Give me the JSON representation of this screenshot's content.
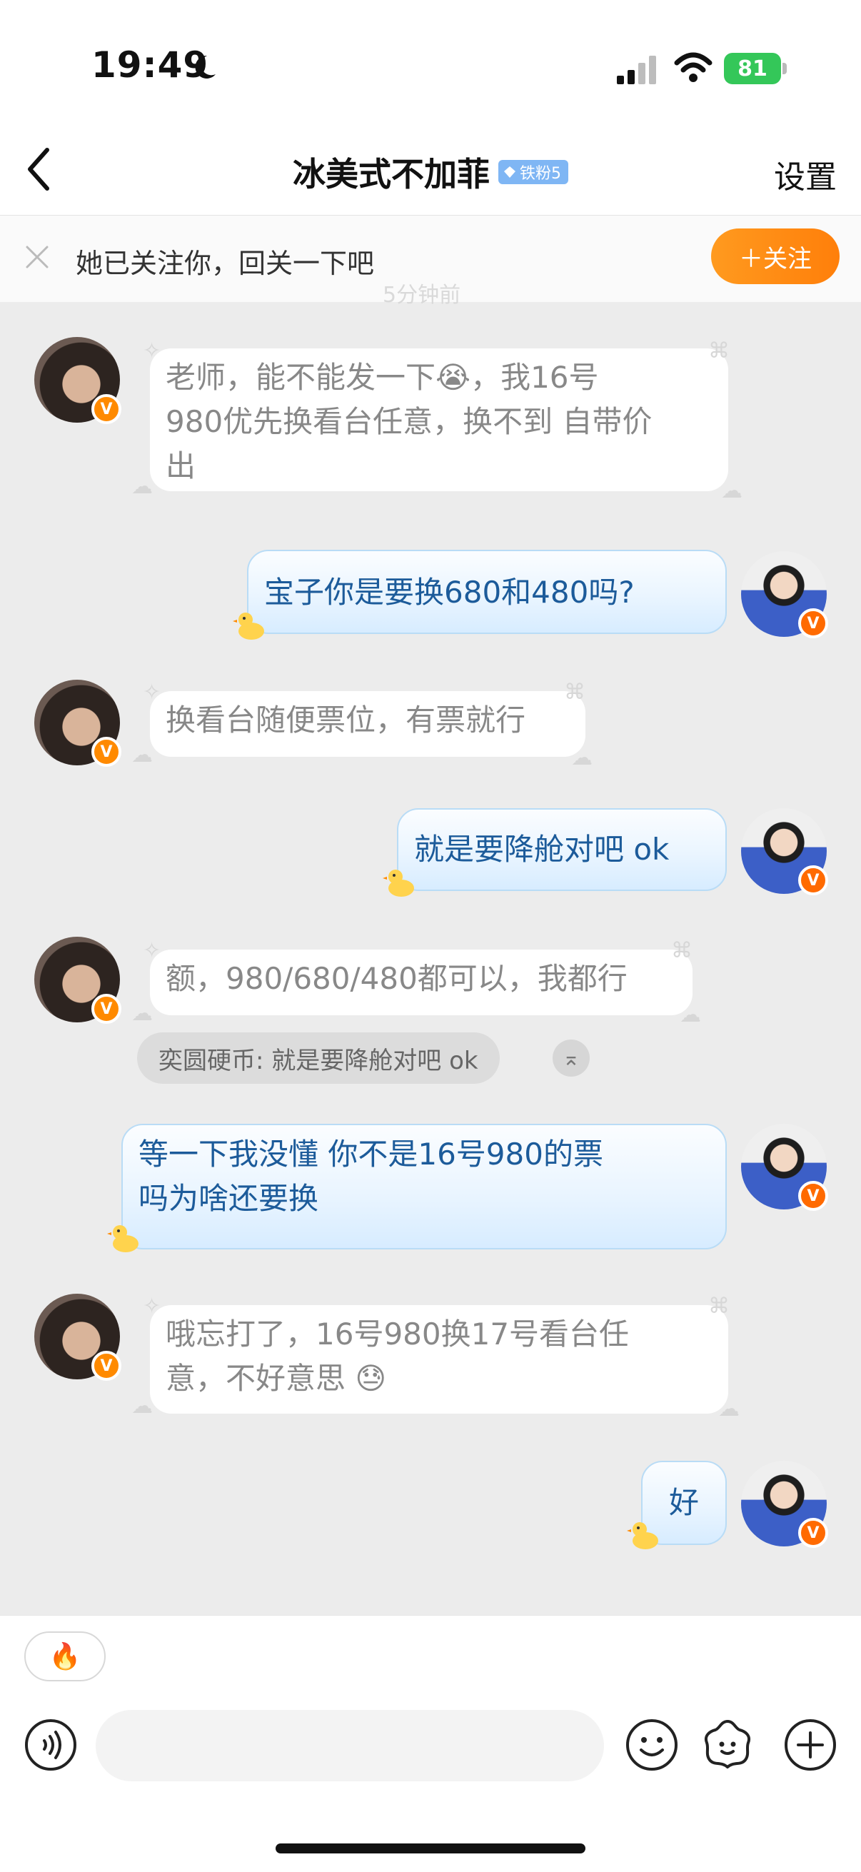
{
  "status": {
    "time": "19:49",
    "battery": "81"
  },
  "nav": {
    "title": "冰美式不加菲",
    "badge": "铁粉5",
    "settings": "设置"
  },
  "banner": {
    "text": "她已关注你，回关一下吧",
    "follow": "＋关注",
    "time_hint": "5分钟前"
  },
  "messages": [
    {
      "side": "left",
      "lines": [
        "老师，能不能发一下😭，我16号",
        "980优先换看台任意，换不到 自带价",
        "出"
      ]
    },
    {
      "side": "right",
      "lines": [
        "宝子你是要换680和480吗?"
      ]
    },
    {
      "side": "left",
      "lines": [
        "换看台随便票位，有票就行"
      ]
    },
    {
      "side": "right",
      "lines": [
        "就是要降舱对吧 ok"
      ]
    },
    {
      "side": "left",
      "lines": [
        "额，980/680/480都可以，我都行"
      ],
      "quote": "奕圆硬币: 就是要降舱对吧 ok"
    },
    {
      "side": "right",
      "lines": [
        "等一下我没懂 你不是16号980的票",
        "吗为啥还要换"
      ]
    },
    {
      "side": "left",
      "lines": [
        "哦忘打了，16号980换17号看台任",
        "意，不好意思 😓"
      ]
    },
    {
      "side": "right",
      "lines": [
        "好"
      ]
    }
  ],
  "avatar_badge": "V",
  "quote_arrow": "⌅",
  "bottom": {
    "fire": "🔥",
    "input_placeholder": ""
  },
  "colors": {
    "follow": "#ff8c14",
    "right_bubble_text": "#1c5b9a",
    "left_bubble_text": "#888888",
    "badge": "#ff8a00"
  }
}
